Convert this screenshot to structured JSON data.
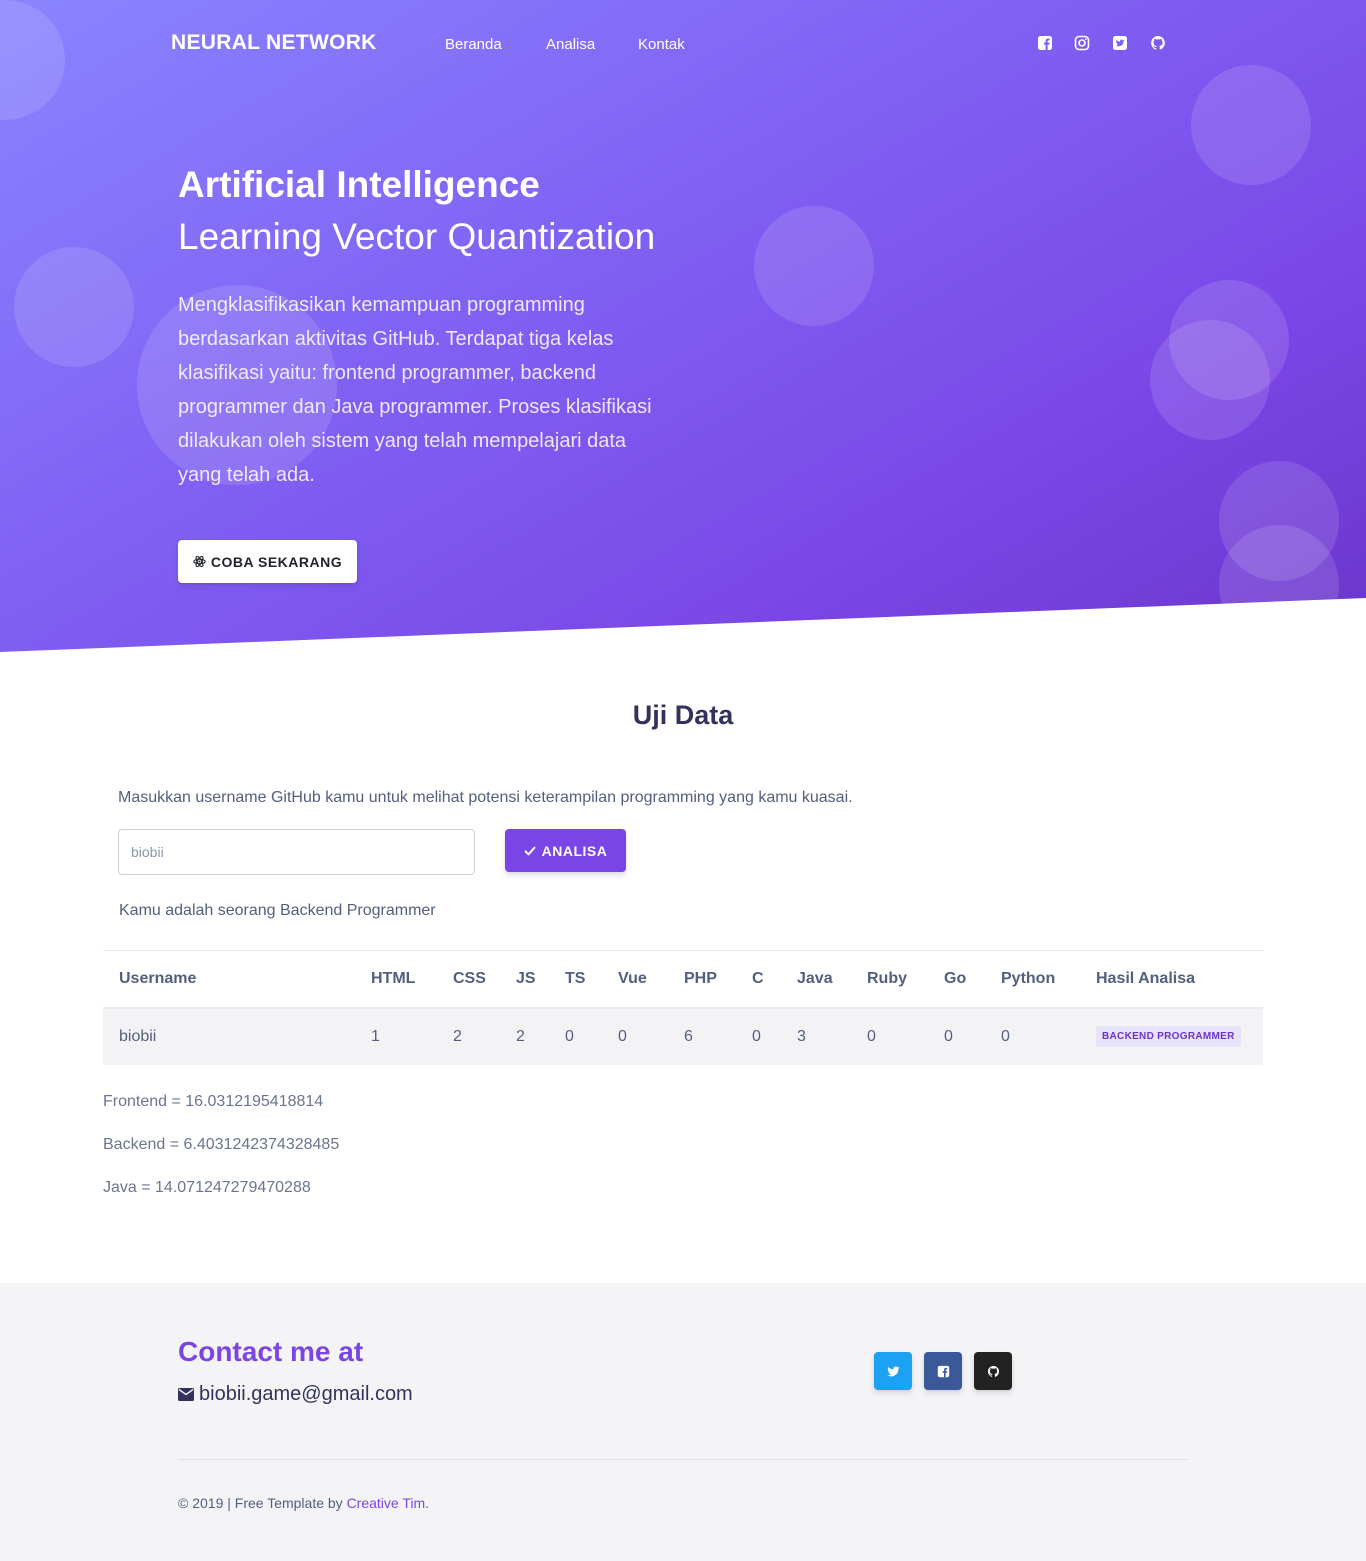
{
  "nav": {
    "brand": "NEURAL NETWORK",
    "links": [
      "Beranda",
      "Analisa",
      "Kontak"
    ],
    "icons": [
      "facebook-icon",
      "instagram-icon",
      "twitter-icon",
      "github-icon"
    ]
  },
  "hero": {
    "title": "Artificial Intelligence",
    "subtitle": "Learning Vector Quantization",
    "description": "Mengklasifikasikan kemampuan programming berdasarkan aktivitas GitHub. Terdapat tiga kelas klasifikasi yaitu: frontend programmer, backend programmer dan Java programmer. Proses klasifikasi dilakukan oleh sistem yang telah mempelajari data yang telah ada.",
    "cta_label": "COBA SEKARANG",
    "cta_icon": "atom-icon"
  },
  "uji": {
    "title": "Uji Data",
    "prompt": "Masukkan username GitHub kamu untuk melihat potensi keterampilan programming yang kamu kuasai.",
    "input_value": "biobii",
    "button_label": "ANALISA",
    "button_icon": "check-icon",
    "result_text": "Kamu adalah seorang Backend Programmer"
  },
  "table": {
    "headers": [
      "Username",
      "HTML",
      "CSS",
      "JS",
      "TS",
      "Vue",
      "PHP",
      "C",
      "Java",
      "Ruby",
      "Go",
      "Python",
      "Hasil Analisa"
    ],
    "rows": [
      {
        "cells": [
          "biobii",
          "1",
          "2",
          "2",
          "0",
          "0",
          "6",
          "0",
          "3",
          "0",
          "0",
          "0"
        ],
        "badge": "BACKEND PROGRAMMER"
      }
    ]
  },
  "scores": [
    "Frontend = 16.0312195418814",
    "Backend = 6.4031242374328485",
    "Java = 14.071247279470288"
  ],
  "footer": {
    "contact_title": "Contact me at",
    "email": "biobii.game@gmail.com",
    "social": [
      {
        "name": "twitter",
        "color": "#1da1f2"
      },
      {
        "name": "facebook",
        "color": "#3b5999"
      },
      {
        "name": "github",
        "color": "#222222"
      }
    ],
    "copyright_prefix": "© 2019 | Free Template by ",
    "copyright_link": "Creative Tim",
    "copyright_suffix": "."
  },
  "colors": {
    "primary": "#7b45e6",
    "heading": "#32325d",
    "text": "#525f7f"
  }
}
